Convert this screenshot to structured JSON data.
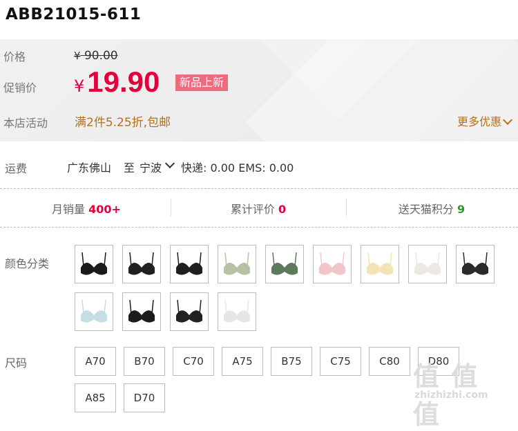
{
  "product": {
    "title": "ABB21015-611"
  },
  "price": {
    "label": "价格",
    "currency": "¥",
    "original": "90.00",
    "promo_label": "促销价",
    "promo_amount": "19.90",
    "tag": "新品上新"
  },
  "activity": {
    "label": "本店活动",
    "text": "满2件5.25折,包邮",
    "more": "更多优惠"
  },
  "shipping": {
    "label": "运费",
    "from": "广东佛山",
    "to_word": "至",
    "destination": "宁波",
    "fees": "快递: 0.00 EMS: 0.00"
  },
  "stats": {
    "monthly_label": "月销量",
    "monthly_value": "400+",
    "reviews_label": "累计评价",
    "reviews_value": "0",
    "points_label": "送天猫积分",
    "points_value": "9"
  },
  "color": {
    "label": "颜色分类",
    "swatches": [
      {
        "color": "#1a1a1a"
      },
      {
        "color": "#202020"
      },
      {
        "color": "#1f1f1f"
      },
      {
        "color": "#b7c2a5"
      },
      {
        "color": "#5e7a5c"
      },
      {
        "color": "#f2c5cb"
      },
      {
        "color": "#f3e4b8"
      },
      {
        "color": "#ece8e2"
      },
      {
        "color": "#2a2a2a"
      },
      {
        "color": "#c5dde4"
      },
      {
        "color": "#1b1b1b"
      },
      {
        "color": "#222222"
      },
      {
        "color": "#e6e6e6"
      }
    ]
  },
  "size": {
    "label": "尺码",
    "options": [
      "A70",
      "B70",
      "C70",
      "A75",
      "B75",
      "C75",
      "C80",
      "D80",
      "A85",
      "D70"
    ]
  },
  "watermark": {
    "big": "值 值 值",
    "small": "zhizhizhi.com"
  }
}
